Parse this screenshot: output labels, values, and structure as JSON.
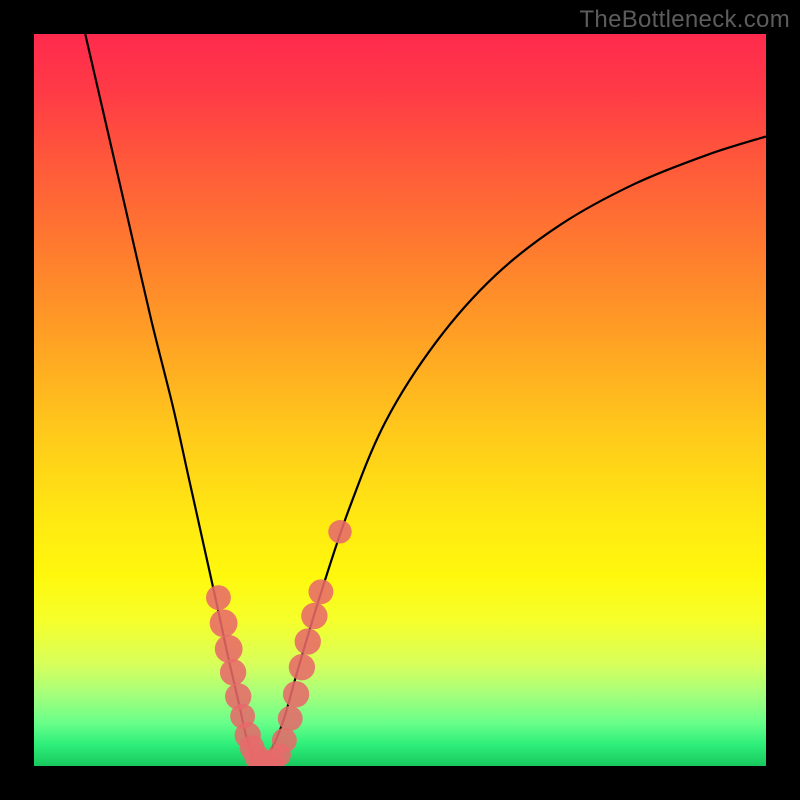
{
  "watermark": "TheBottleneck.com",
  "chart_data": {
    "type": "line",
    "title": "",
    "xlabel": "",
    "ylabel": "",
    "xlim": [
      0,
      100
    ],
    "ylim": [
      0,
      100
    ],
    "grid": false,
    "legend": false,
    "series": [
      {
        "name": "left-curve",
        "x": [
          7,
          10,
          13,
          16,
          19,
          21,
          23,
          25,
          26.5,
          28,
          29,
          30,
          30.5
        ],
        "y": [
          100,
          87,
          74,
          61,
          49,
          40,
          31,
          22,
          15,
          8.5,
          4,
          1.2,
          0.3
        ]
      },
      {
        "name": "right-curve",
        "x": [
          30.5,
          32,
          34,
          36,
          39,
          43,
          48,
          55,
          63,
          72,
          82,
          92,
          100
        ],
        "y": [
          0.3,
          1.5,
          6,
          13,
          23,
          35,
          47,
          58,
          67,
          74,
          79.5,
          83.5,
          86
        ]
      }
    ],
    "markers": [
      {
        "x": 25.2,
        "y": 23.0,
        "r": 1.7
      },
      {
        "x": 25.9,
        "y": 19.5,
        "r": 1.9
      },
      {
        "x": 26.6,
        "y": 16.0,
        "r": 1.9
      },
      {
        "x": 27.2,
        "y": 12.8,
        "r": 1.8
      },
      {
        "x": 27.9,
        "y": 9.5,
        "r": 1.8
      },
      {
        "x": 28.5,
        "y": 6.8,
        "r": 1.7
      },
      {
        "x": 29.2,
        "y": 4.2,
        "r": 1.8
      },
      {
        "x": 29.8,
        "y": 2.5,
        "r": 1.7
      },
      {
        "x": 30.4,
        "y": 1.3,
        "r": 1.7
      },
      {
        "x": 31.0,
        "y": 0.7,
        "r": 1.6
      },
      {
        "x": 31.8,
        "y": 0.4,
        "r": 1.6
      },
      {
        "x": 32.7,
        "y": 0.7,
        "r": 1.6
      },
      {
        "x": 33.5,
        "y": 1.5,
        "r": 1.6
      },
      {
        "x": 34.2,
        "y": 3.5,
        "r": 1.7
      },
      {
        "x": 35.0,
        "y": 6.5,
        "r": 1.7
      },
      {
        "x": 35.8,
        "y": 9.8,
        "r": 1.8
      },
      {
        "x": 36.6,
        "y": 13.5,
        "r": 1.8
      },
      {
        "x": 37.4,
        "y": 17.0,
        "r": 1.8
      },
      {
        "x": 38.3,
        "y": 20.5,
        "r": 1.8
      },
      {
        "x": 39.2,
        "y": 23.8,
        "r": 1.7
      },
      {
        "x": 41.8,
        "y": 32.0,
        "r": 1.6
      }
    ],
    "marker_color": "#e76a6a",
    "curve_color": "#000000"
  }
}
